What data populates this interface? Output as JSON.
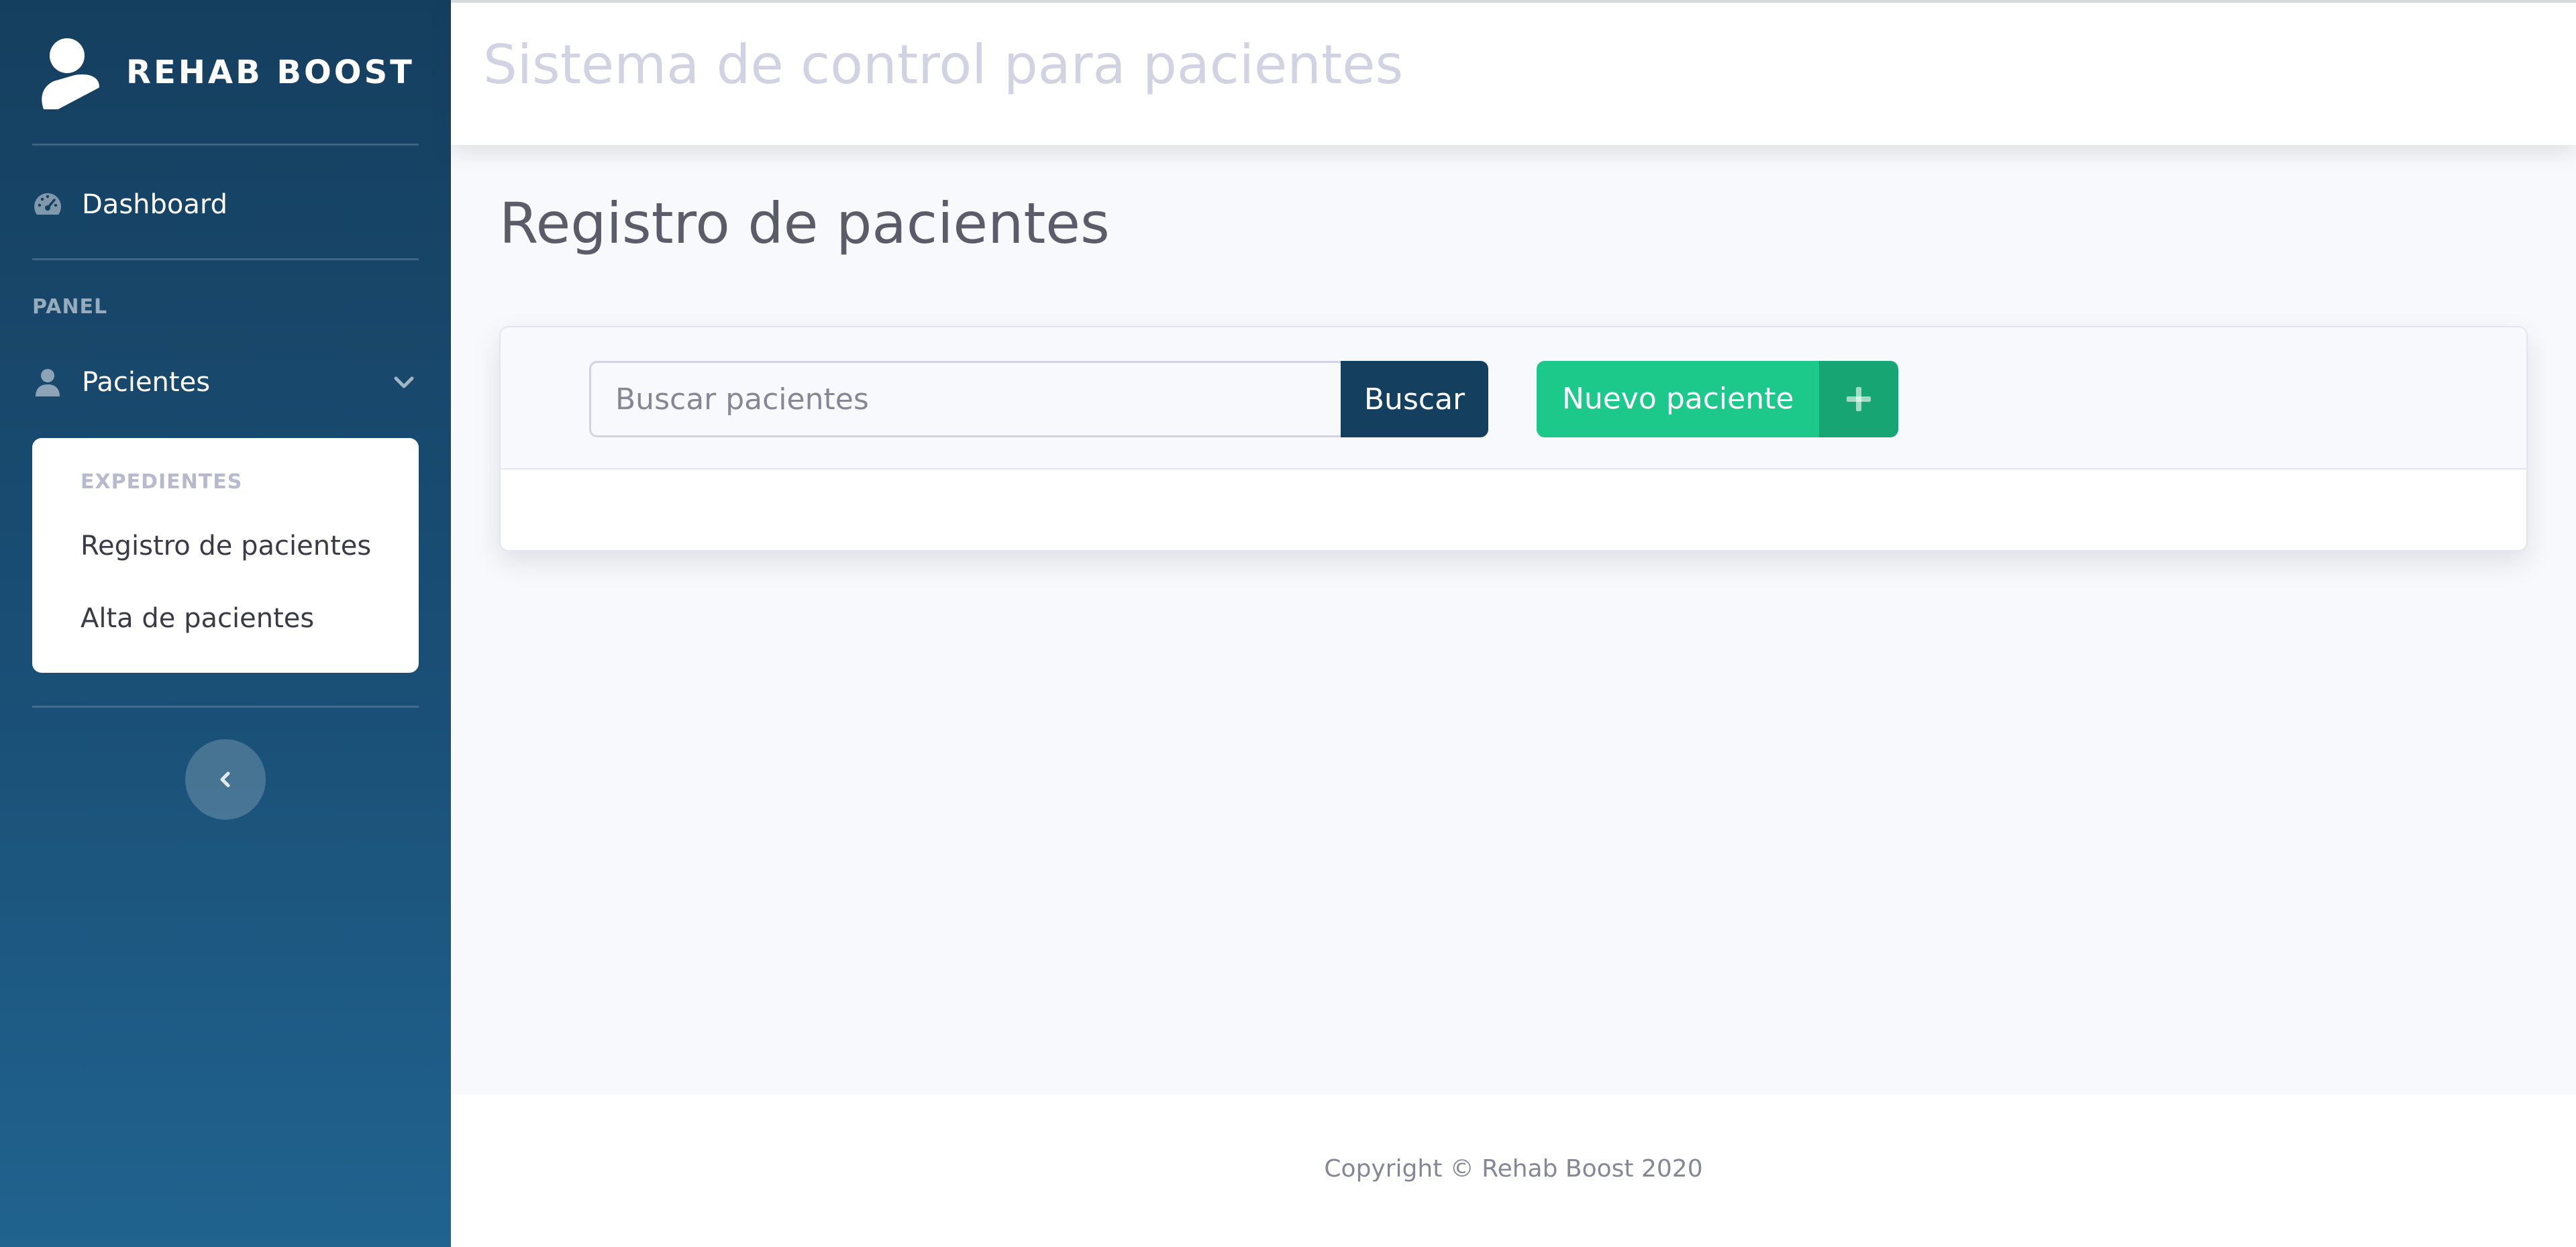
{
  "brand": {
    "name": "REHAB BOOST",
    "icon": "user-icon"
  },
  "sidebar": {
    "dashboard": {
      "label": "Dashboard",
      "icon": "tachometer-icon"
    },
    "heading": "PANEL",
    "patients": {
      "label": "Pacientes",
      "icon": "user-icon",
      "expanded": true
    },
    "collapse": {
      "header": "EXPEDIENTES",
      "items": [
        {
          "label": "Registro de pacientes"
        },
        {
          "label": "Alta de pacientes"
        }
      ]
    },
    "toggle_icon": "chevron-left-icon"
  },
  "topbar": {
    "title": "Sistema de control para pacientes"
  },
  "main": {
    "page_title": "Registro de pacientes",
    "search": {
      "placeholder": "Buscar pacientes",
      "value": "",
      "button_label": "Buscar"
    },
    "new_patient": {
      "label": "Nuevo paciente",
      "icon": "plus-icon"
    }
  },
  "footer": {
    "copyright": "Copyright © Rehab Boost 2020"
  },
  "colors": {
    "sidebar_top": "#153f5f",
    "sidebar_bottom": "#20638f",
    "primary_dark": "#153f5f",
    "success": "#1cc88a",
    "success_dark": "#17a673",
    "page_bg": "#f8f9fc"
  }
}
